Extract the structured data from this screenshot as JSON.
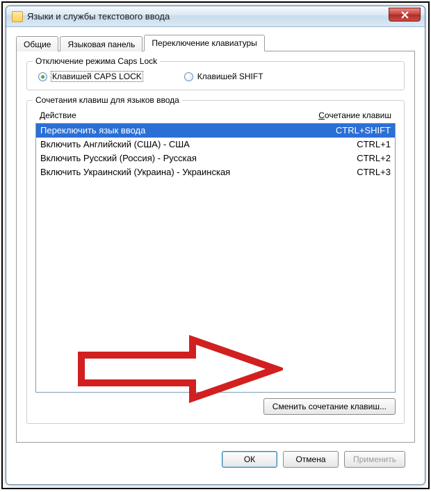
{
  "window": {
    "title": "Языки и службы текстового ввода"
  },
  "tabs": {
    "general": "Общие",
    "language_bar": "Языковая панель",
    "keyboard_switch": "Переключение клавиатуры",
    "active_index": 2
  },
  "capslock_group": {
    "title": "Отключение режима Caps Lock",
    "radio_caps": "Клавишей CAPS LOCK",
    "radio_shift": "Клавишей SHIFT",
    "selected": "caps"
  },
  "hotkeys_group": {
    "title": "Сочетания клавиш для языков ввода",
    "col_action": "Действие",
    "col_key_prefix": "С",
    "col_key_rest": "очетание клавиш",
    "rows": [
      {
        "action": "Переключить язык ввода",
        "hotkey": "CTRL+SHIFT",
        "selected": true
      },
      {
        "action": "Включить Английский (США) - США",
        "hotkey": "CTRL+1",
        "selected": false
      },
      {
        "action": "Включить Русский (Россия) - Русская",
        "hotkey": "CTRL+2",
        "selected": false
      },
      {
        "action": "Включить Украинский (Украина) - Украинская",
        "hotkey": "CTRL+3",
        "selected": false
      }
    ],
    "change_button": "Сменить сочетание клавиш..."
  },
  "footer": {
    "ok": "ОК",
    "cancel": "Отмена",
    "apply": "Применить",
    "apply_enabled": false
  }
}
